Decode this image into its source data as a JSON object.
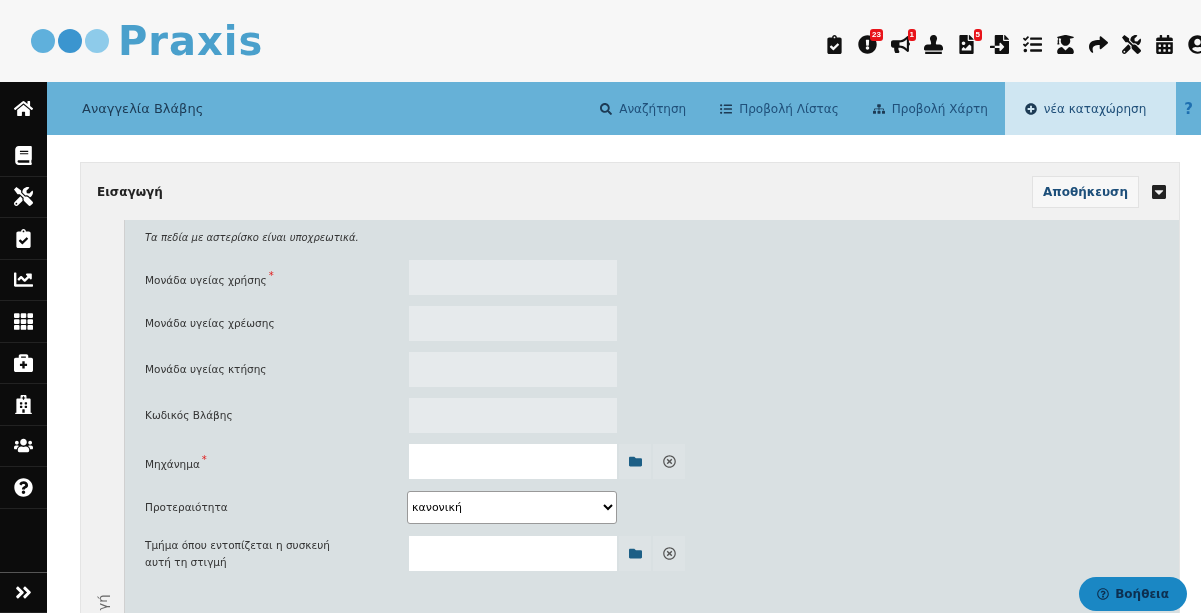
{
  "header": {
    "logo": "Praxis",
    "badges": [
      "23",
      "1",
      "5"
    ]
  },
  "navbar": {
    "title": "Αναγγελία Βλάβης",
    "tabs": [
      {
        "label": "Αναζήτηση",
        "selected": false
      },
      {
        "label": "Προβολή Λίστας",
        "selected": false
      },
      {
        "label": "Προβολή Χάρτη",
        "selected": false
      },
      {
        "label": "νέα καταχώρηση",
        "selected": true
      }
    ],
    "help": "?"
  },
  "panel": {
    "title": "Εισαγωγή",
    "save_button": "Αποθήκευση",
    "side_tab": "γή",
    "note": "Τα πεδία με αστερίσκο είναι υποχρεωτικά.",
    "fields": [
      {
        "label": "Μονάδα υγείας χρήσης",
        "mark": "*",
        "kind": "readonly"
      },
      {
        "label": "Μονάδα υγείας χρέωσης",
        "kind": "readonly"
      },
      {
        "label": "Μονάδα υγείας κτήσης",
        "kind": "readonly"
      },
      {
        "label": "Κωδικός Βλάβης",
        "kind": "readonly"
      },
      {
        "label": "Μηχάνημα",
        "mark": "*",
        "kind": "lookup"
      },
      {
        "label": "Προτεραιότητα",
        "kind": "select",
        "value": "κανονική"
      },
      {
        "label": "Τμήμα όπου εντοπίζεται η συσκευή αυτή τη στιγμή",
        "kind": "lookup"
      }
    ]
  },
  "help_button": "Βοήθεια"
}
